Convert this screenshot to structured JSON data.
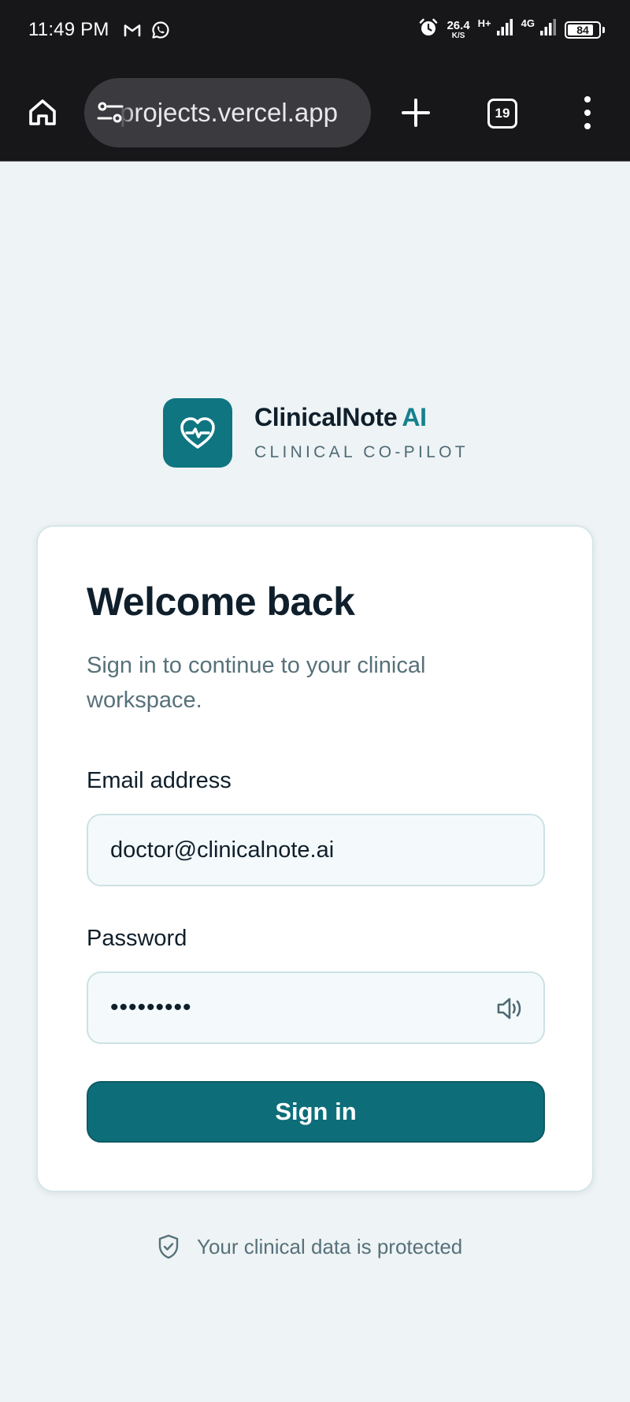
{
  "status_bar": {
    "time": "11:49 PM",
    "net_speed_value": "26.4",
    "net_speed_unit": "K/S",
    "network_label_1": "H+",
    "network_label_2": "4G",
    "battery_level": "84",
    "battery_percent": 84,
    "icons": [
      "gmail-icon",
      "whatsapp-icon",
      "alarm-icon",
      "signal-icon",
      "signal-icon",
      "battery-icon"
    ]
  },
  "browser": {
    "url": "projects.vercel.app",
    "tab_count": "19",
    "icons": [
      "home-icon",
      "site-settings-icon",
      "plus-icon",
      "more-vert-icon"
    ]
  },
  "brand": {
    "name": "ClinicalNote",
    "name_accent": "AI",
    "tagline": "CLINICAL CO-PILOT",
    "logo_icon": "heart-pulse-icon"
  },
  "login": {
    "title": "Welcome back",
    "subtitle": "Sign in to continue to your clinical workspace.",
    "email_label": "Email address",
    "email_value": "doctor@clinicalnote.ai",
    "password_label": "Password",
    "password_value": "password1",
    "toggle_icon": "speaker-icon",
    "submit_label": "Sign in"
  },
  "footer": {
    "secure_note": "Your clinical data is protected",
    "icon": "shield-check-icon"
  },
  "colors": {
    "status_bar_bg": "#17171a",
    "page_bg": "#eef3f5",
    "brand_teal": "#0f7581",
    "button_teal": "#0d6e7a",
    "heading_text": "#0f1f2b",
    "muted_text": "#57717a"
  }
}
